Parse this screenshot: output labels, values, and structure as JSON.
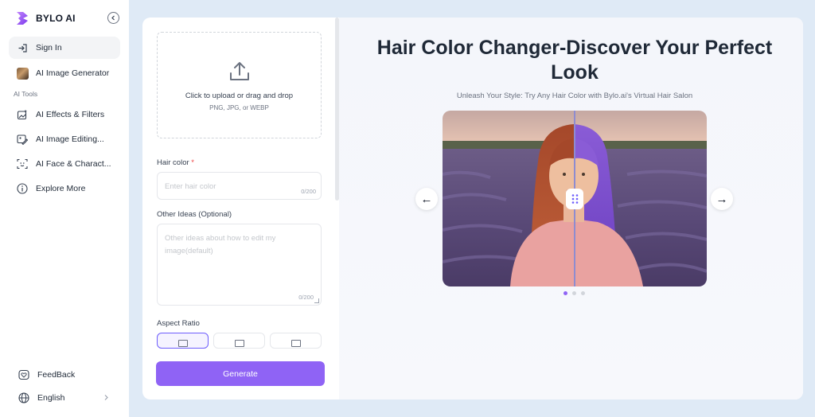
{
  "brand": {
    "name": "BYLO AI"
  },
  "sidebar": {
    "signin": "Sign In",
    "generator": "AI Image Generator",
    "section_label": "AI Tools",
    "items": [
      {
        "label": "AI Effects & Filters",
        "icon": "sparkle-image-icon"
      },
      {
        "label": "AI Image Editing...",
        "icon": "edit-image-icon"
      },
      {
        "label": "AI Face & Charact...",
        "icon": "face-scan-icon"
      },
      {
        "label": "Explore More",
        "icon": "info-circle-icon"
      }
    ],
    "feedback": "FeedBack",
    "language": "English"
  },
  "form": {
    "upload_title": "Click to upload or drag and drop",
    "upload_formats": "PNG, JPG, or WEBP",
    "hair_color_label": "Hair color",
    "required_mark": "*",
    "hair_color_placeholder": "Enter hair color",
    "hair_color_count": "0/200",
    "other_ideas_label": "Other Ideas (Optional)",
    "other_ideas_placeholder": "Other ideas about how to edit my image(default)",
    "other_ideas_count": "0/200",
    "aspect_ratio_label": "Aspect Ratio",
    "aspect_ratio_selected": 0,
    "generate_label": "Generate"
  },
  "preview": {
    "headline_line1": "Hair Color Changer-Discover Your Perfect",
    "headline_line2": "Look",
    "subtitle": "Unleash Your Style: Try Any Hair Color with Bylo.ai's Virtual Hair Salon",
    "prev_arrow": "←",
    "next_arrow": "→",
    "slides_total": 3,
    "slide_active": 1
  },
  "colors": {
    "accent": "#8f63f5",
    "selected_border": "#6d5dfc",
    "page_bg": "#dfeaf6"
  }
}
